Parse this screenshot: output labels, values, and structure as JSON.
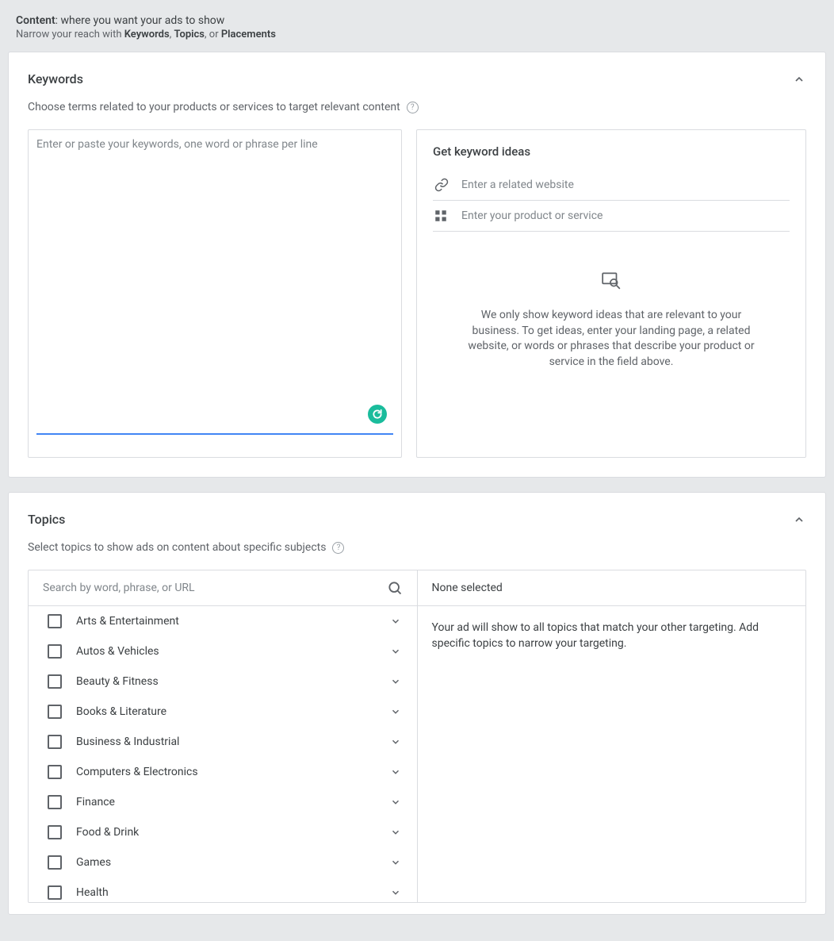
{
  "header": {
    "content_label": "Content",
    "content_tail": ": where you want your ads to show",
    "narrow_prefix": "Narrow your reach with ",
    "kw": "Keywords",
    "sep1": ", ",
    "tp": "Topics",
    "sep2": ", or ",
    "pl": "Placements"
  },
  "keywords": {
    "title": "Keywords",
    "subtitle": "Choose terms related to your products or services to target relevant content",
    "textarea_placeholder": "Enter or paste your keywords, one word or phrase per line",
    "ideas": {
      "title": "Get keyword ideas",
      "website_placeholder": "Enter a related website",
      "product_placeholder": "Enter your product or service",
      "empty_text": "We only show keyword ideas that are relevant to your business. To get ideas, enter your landing page, a related website, or words or phrases that describe your product or service in the field above."
    }
  },
  "topics": {
    "title": "Topics",
    "subtitle": "Select topics to show ads on content about specific subjects",
    "search_placeholder": "Search by word, phrase, or URL",
    "none_selected": "None selected",
    "right_body": "Your ad will show to all topics that match your other targeting. Add specific topics to narrow your targeting.",
    "items": [
      {
        "label": "Arts & Entertainment"
      },
      {
        "label": "Autos & Vehicles"
      },
      {
        "label": "Beauty & Fitness"
      },
      {
        "label": "Books & Literature"
      },
      {
        "label": "Business & Industrial"
      },
      {
        "label": "Computers & Electronics"
      },
      {
        "label": "Finance"
      },
      {
        "label": "Food & Drink"
      },
      {
        "label": "Games"
      },
      {
        "label": "Health"
      }
    ]
  }
}
